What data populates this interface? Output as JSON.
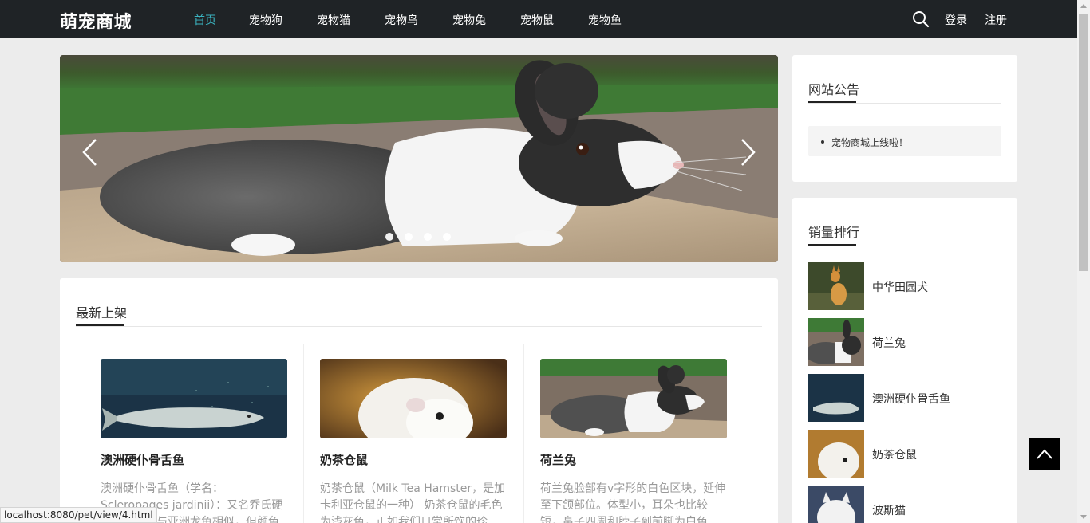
{
  "header": {
    "brand": "萌宠商城",
    "nav": [
      {
        "label": "首页",
        "active": true
      },
      {
        "label": "宠物狗"
      },
      {
        "label": "宠物猫"
      },
      {
        "label": "宠物鸟"
      },
      {
        "label": "宠物兔"
      },
      {
        "label": "宠物鼠"
      },
      {
        "label": "宠物鱼"
      }
    ],
    "search_icon": "search-icon",
    "login": "登录",
    "register": "注册"
  },
  "colors": {
    "header_bg": "#1f2326",
    "accent": "#3bb4c1",
    "page_bg": "#ececec"
  },
  "carousel": {
    "slide_count": 4,
    "prev_icon": "chevron-left-icon",
    "next_icon": "chevron-right-icon"
  },
  "latest": {
    "title": "最新上架",
    "cards": [
      {
        "name": "澳洲硬仆骨舌鱼",
        "desc": "澳洲硬仆骨舌鱼（学名：Scleropages jardinii）：又名乔氏硬仆骨舌鱼，与亚洲龙鱼相似，但颜色较"
      },
      {
        "name": "奶茶仓鼠",
        "desc": "奶茶仓鼠（Milk Tea Hamster，是加卡利亚仓鼠的一种） 奶茶仓鼠的毛色为浅灰色，正如我们日常所饮的珍"
      },
      {
        "name": "荷兰兔",
        "desc": "荷兰兔脸部有v字形的白色区块，延伸至下颌部位。体型小，耳朵也比较短，鼻子四周和脖子到前脚为白色"
      }
    ]
  },
  "notice": {
    "title": "网站公告",
    "items": [
      "宠物商城上线啦！"
    ]
  },
  "ranking": {
    "title": "销量排行",
    "items": [
      "中华田园犬",
      "荷兰兔",
      "澳洲硬仆骨舌鱼",
      "奶茶仓鼠",
      "波斯猫"
    ]
  },
  "back_to_top_icon": "arrow-up-icon",
  "status_url": "localhost:8080/pet/view/4.html"
}
